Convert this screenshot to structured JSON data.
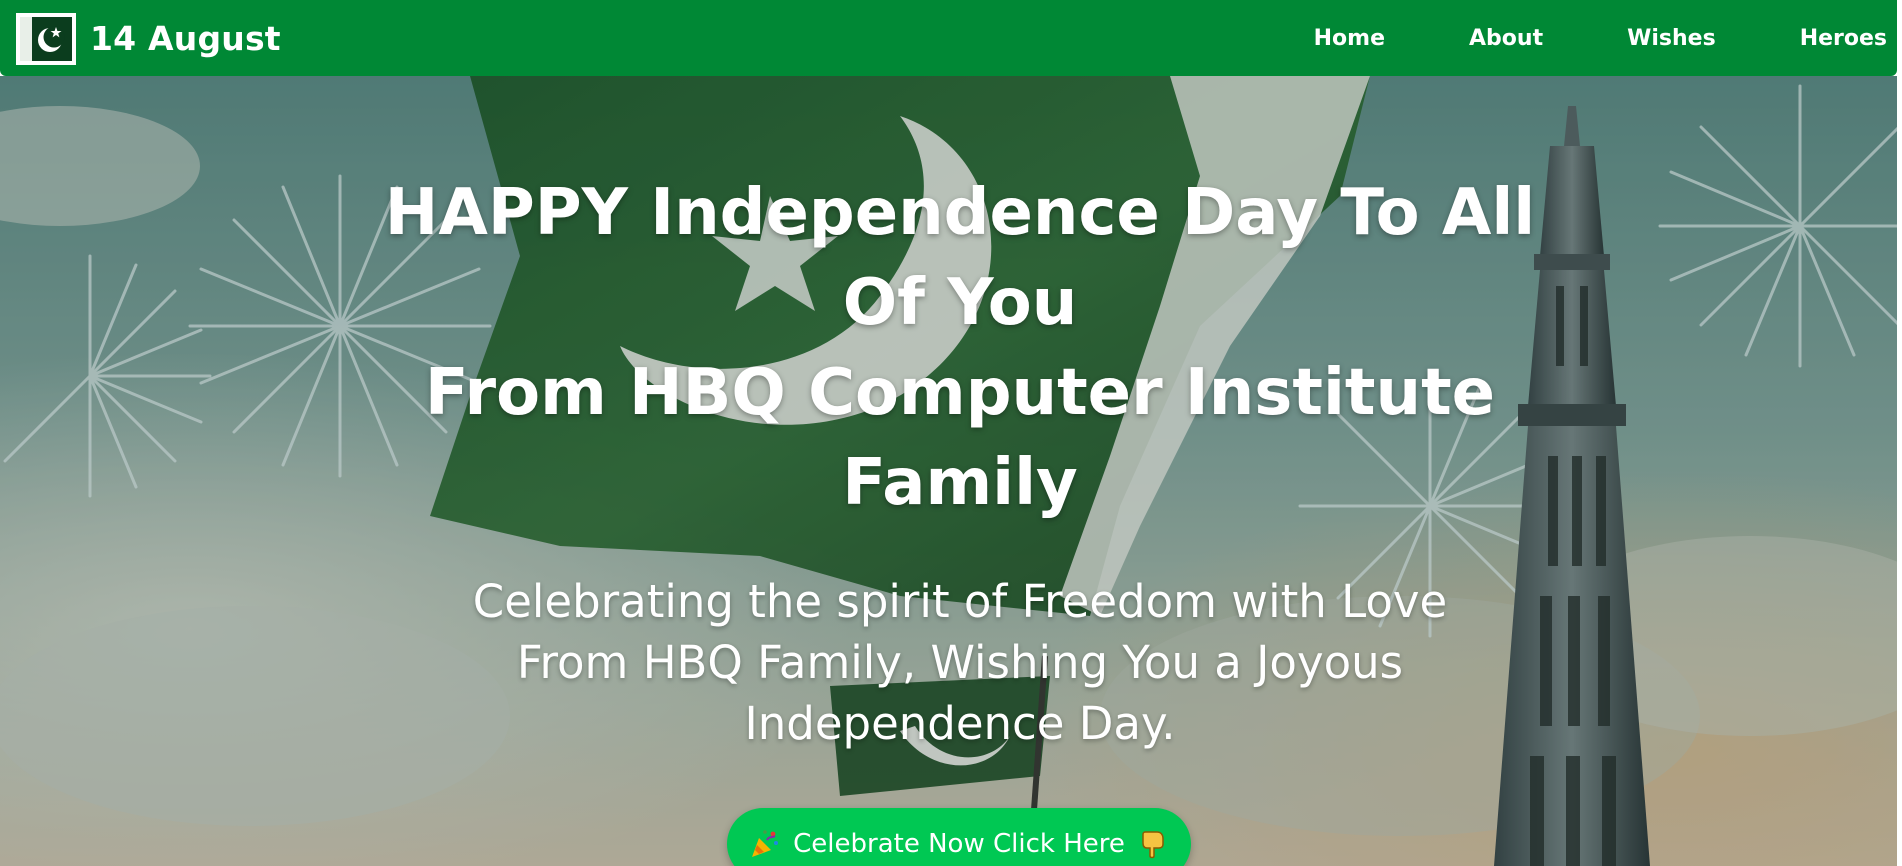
{
  "colors": {
    "navbar": "#008835",
    "cta_button": "#00c853",
    "text": "#ffffff"
  },
  "navbar": {
    "brand_icon": "pakistan-flag-icon",
    "brand_text": "14 August",
    "links": [
      {
        "label": "Home"
      },
      {
        "label": "About"
      },
      {
        "label": "Wishes"
      },
      {
        "label": "Heroes"
      }
    ]
  },
  "hero": {
    "background": "pakistan-flag-minar-fireworks-painting",
    "title_line_1": "HAPPY Independence Day To All Of You",
    "title_line_2": "From HBQ Computer Institute Family",
    "subtitle": "Celebrating the spirit of Freedom with Love From HBQ Family, Wishing You a Joyous Independence Day.",
    "cta": {
      "label": "Celebrate Now Click Here",
      "leading_icon": "party-popper-icon",
      "trailing_icon": "pointing-down-hand-icon"
    }
  }
}
